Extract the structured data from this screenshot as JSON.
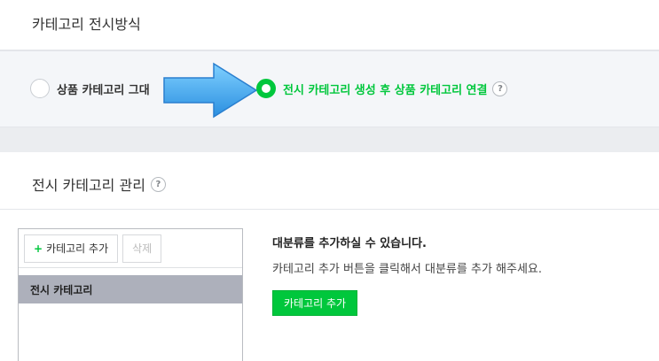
{
  "display_section": {
    "title": "카테고리 전시방식",
    "options": [
      {
        "label": "상품 카테고리 그대",
        "selected": false
      },
      {
        "label": "전시 카테고리 생성 후 상품 카테고리 연결",
        "selected": true
      }
    ],
    "help_glyph": "?"
  },
  "manage_section": {
    "title": "전시 카테고리 관리",
    "help_glyph": "?",
    "toolbar": {
      "add_label": "카테고리 추가",
      "add_icon": "plus-icon",
      "delete_label": "삭제"
    },
    "tree": [
      {
        "label": "전시 카테고리",
        "selected": true
      }
    ],
    "info": {
      "title": "대분류를 추가하실 수 있습니다.",
      "description": "카테고리 추가 버튼을 클릭해서 대분류를 추가 해주세요.",
      "button_label": "카테고리 추가"
    }
  },
  "colors": {
    "accent": "#00c73c",
    "arrow": "#3ba8f0",
    "selected_row": "#adb0bb"
  }
}
